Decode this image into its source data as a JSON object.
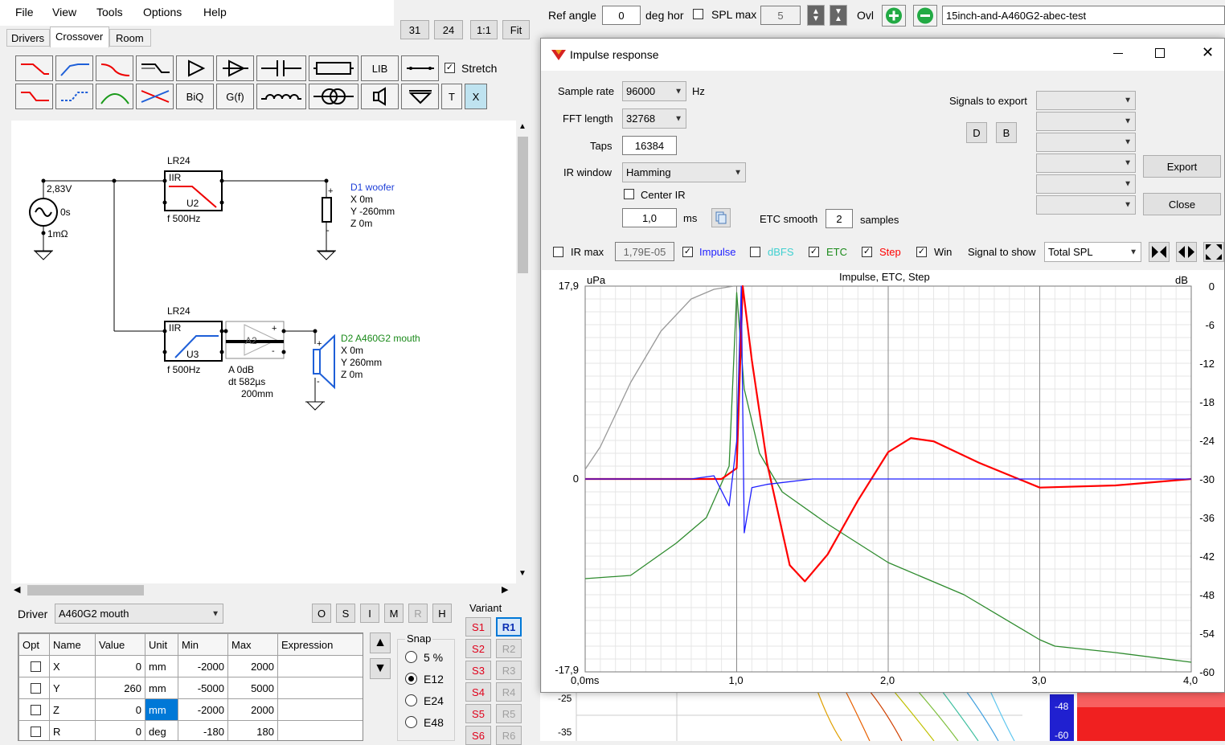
{
  "menu": [
    "File",
    "View",
    "Tools",
    "Options",
    "Help"
  ],
  "tabs": [
    "Drivers",
    "Crossover",
    "Room"
  ],
  "zoom": {
    "a": "31",
    "b": "24",
    "one": "1:1",
    "fit": "Fit"
  },
  "toolbar": {
    "ref_angle_label": "Ref angle",
    "ref_angle": "0",
    "deg_hor": "deg hor",
    "spl_max": "SPL max",
    "spl_val": "5",
    "ovl": "Ovl",
    "project": "15inch-and-A460G2-abec-test"
  },
  "palette": {
    "stretch": "Stretch",
    "lib": "LIB",
    "biq": "BiQ",
    "gf": "G(f)",
    "t": "T",
    "x": "X"
  },
  "schematic": {
    "source_v": "2,83V",
    "source_t": "0s",
    "source_r": "1mΩ",
    "f1_type": "LR24",
    "f1_kind": "IIR",
    "f1_id": "U2",
    "f1_f": "f   500Hz",
    "f2_type": "LR24",
    "f2_kind": "IIR",
    "f2_id": "U3",
    "f2_f": "f   500Hz",
    "d1_name": "D1 woofer",
    "d1_x": "X 0m",
    "d1_y": "Y -260mm",
    "d1_z": "Z 0m",
    "d2_name": "D2 A460G2 mouth",
    "d2_x": "X 0m",
    "d2_y": "Y 260mm",
    "d2_z": "Z 0m",
    "amp_id": "A2",
    "amp_a": "A  0dB",
    "amp_dt": "dt 582µs",
    "amp_mm": "200mm"
  },
  "driver_panel": {
    "label": "Driver",
    "selected": "A460G2 mouth",
    "buttons": [
      "O",
      "S",
      "I",
      "M",
      "R",
      "H"
    ],
    "headers": [
      "Opt",
      "Name",
      "Value",
      "Unit",
      "Min",
      "Max",
      "Expression"
    ],
    "rows": [
      {
        "name": "X",
        "value": "0",
        "unit": "mm",
        "min": "-2000",
        "max": "2000"
      },
      {
        "name": "Y",
        "value": "260",
        "unit": "mm",
        "min": "-5000",
        "max": "5000"
      },
      {
        "name": "Z",
        "value": "0",
        "unit": "mm",
        "min": "-2000",
        "max": "2000"
      },
      {
        "name": "R",
        "value": "0",
        "unit": "deg",
        "min": "-180",
        "max": "180"
      }
    ],
    "snap_label": "Snap",
    "snap_options": [
      "5 %",
      "E12",
      "E24",
      "E48"
    ],
    "variant_label": "Variant",
    "variants_s": [
      "S1",
      "S2",
      "S3",
      "S4",
      "S5",
      "S6"
    ],
    "variants_r": [
      "R1",
      "R2",
      "R3",
      "R4",
      "R5",
      "R6"
    ]
  },
  "background_chart": {
    "y1": "-25",
    "y2": "-35",
    "c1": "-48",
    "c2": "-60"
  },
  "dialog": {
    "title": "Impulse response",
    "sample_rate_label": "Sample rate",
    "sample_rate": "96000",
    "hz": "Hz",
    "fft_label": "FFT length",
    "fft": "32768",
    "taps_label": "Taps",
    "taps": "16384",
    "irwin_label": "IR window",
    "irwin": "Hamming",
    "center_ir": "Center IR",
    "ms_value": "1,0",
    "ms": "ms",
    "etc_smooth_label": "ETC smooth",
    "etc_smooth": "2",
    "samples": "samples",
    "signals_export": "Signals to export",
    "d": "D",
    "b": "B",
    "export": "Export",
    "close": "Close",
    "irmax": "IR max",
    "irmax_val": "1,79E-05",
    "impulse": "Impulse",
    "dbfs": "dBFS",
    "etc": "ETC",
    "step": "Step",
    "win": "Win",
    "signal_show_label": "Signal to show",
    "signal_show": "Total SPL"
  },
  "chart_data": {
    "type": "line",
    "title": "Impulse, ETC, Step",
    "ylabel_left": "uPa",
    "ylabel_right": "dB",
    "x_ticks": [
      "0,0ms",
      "1,0",
      "2,0",
      "3,0",
      "4,0"
    ],
    "xlim": [
      0,
      4
    ],
    "y_left_ticks": [
      "17,9",
      "0",
      "-17,9"
    ],
    "ylim_left": [
      -17.9,
      17.9
    ],
    "y_right_ticks": [
      "0",
      "-6",
      "-12",
      "-18",
      "-24",
      "-30",
      "-36",
      "-42",
      "-48",
      "-54",
      "-60"
    ],
    "ylim_right": [
      -60,
      0
    ],
    "grid": true,
    "series": [
      {
        "name": "Impulse",
        "color": "#1e1eff",
        "axis": "left",
        "x": [
          0,
          0.7,
          0.85,
          0.95,
          1.0,
          1.03,
          1.05,
          1.1,
          1.2,
          1.5,
          2.0,
          3.0,
          4.0
        ],
        "y": [
          0,
          0,
          0.3,
          -2.5,
          3.5,
          17.9,
          -5.0,
          -0.8,
          -0.5,
          0,
          0,
          0,
          0
        ]
      },
      {
        "name": "Step",
        "color": "#ff0000",
        "axis": "left",
        "x": [
          0,
          0.9,
          1.0,
          1.04,
          1.1,
          1.2,
          1.35,
          1.45,
          1.6,
          1.8,
          2.0,
          2.15,
          2.3,
          2.6,
          3.0,
          3.5,
          4.0
        ],
        "y": [
          0,
          0,
          1.0,
          17.9,
          11.0,
          1.5,
          -8.0,
          -9.5,
          -7.0,
          -2.0,
          2.5,
          3.8,
          3.5,
          1.5,
          -0.8,
          -0.6,
          0
        ]
      },
      {
        "name": "ETC",
        "color": "#2e8b2e",
        "axis": "right",
        "x": [
          0,
          0.3,
          0.6,
          0.8,
          0.95,
          1.0,
          1.05,
          1.15,
          1.3,
          1.6,
          2.0,
          2.5,
          3.0,
          3.1,
          3.5,
          4.0
        ],
        "y": [
          -45.5,
          -45,
          -40,
          -36,
          -28,
          -1,
          -16,
          -26,
          -32,
          -37,
          -43,
          -48,
          -55,
          -56,
          -57,
          -58.5
        ]
      },
      {
        "name": "Win",
        "color": "#999999",
        "axis": "right",
        "x": [
          0,
          0.1,
          0.3,
          0.5,
          0.7,
          0.85,
          0.98
        ],
        "y": [
          -28.5,
          -25,
          -15,
          -7,
          -2,
          -0.5,
          0
        ]
      }
    ]
  }
}
